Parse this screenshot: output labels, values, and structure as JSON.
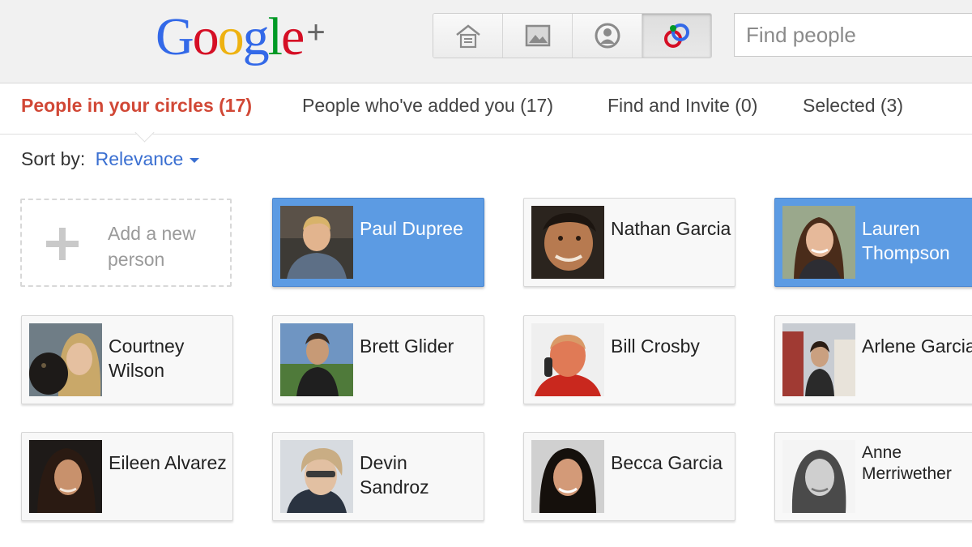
{
  "header": {
    "logo": {
      "letters": [
        {
          "ch": "G",
          "color": "#3369e8"
        },
        {
          "ch": "o",
          "color": "#d50f25"
        },
        {
          "ch": "o",
          "color": "#eeb211"
        },
        {
          "ch": "g",
          "color": "#3369e8"
        },
        {
          "ch": "l",
          "color": "#009925"
        },
        {
          "ch": "e",
          "color": "#d50f25"
        }
      ],
      "plus": "+"
    },
    "nav": [
      {
        "icon": "home-stream-icon",
        "active": false
      },
      {
        "icon": "photos-icon",
        "active": false
      },
      {
        "icon": "profile-icon",
        "active": false
      },
      {
        "icon": "circles-icon",
        "active": true
      }
    ],
    "search": {
      "placeholder": "Find people"
    }
  },
  "tabs": [
    {
      "label": "People in your circles (17)",
      "active": true
    },
    {
      "label": "People who've added you (17)",
      "active": false
    },
    {
      "label": "Find and Invite (0)",
      "active": false
    },
    {
      "label": "Selected (3)",
      "active": false
    }
  ],
  "sort": {
    "label": "Sort by:",
    "value": "Relevance"
  },
  "add_card": {
    "label": "Add a new person"
  },
  "people": [
    {
      "name": "Paul Dupree",
      "selected": true
    },
    {
      "name": "Nathan Garcia",
      "selected": false
    },
    {
      "name": "Lauren Thompson",
      "selected": true
    },
    {
      "name": "Courtney Wilson",
      "selected": false
    },
    {
      "name": "Brett Glider",
      "selected": false
    },
    {
      "name": "Bill Crosby",
      "selected": false
    },
    {
      "name": "Arlene Garcia",
      "selected": false
    },
    {
      "name": "Eileen Alvarez",
      "selected": false
    },
    {
      "name": "Devin Sandroz",
      "selected": false
    },
    {
      "name": "Becca Garcia",
      "selected": false
    },
    {
      "name": "Anne Merriwether",
      "selected": false
    }
  ],
  "colors": {
    "accent_red": "#d14836",
    "link_blue": "#3a6fd1",
    "selected_card": "#5c9be3"
  }
}
